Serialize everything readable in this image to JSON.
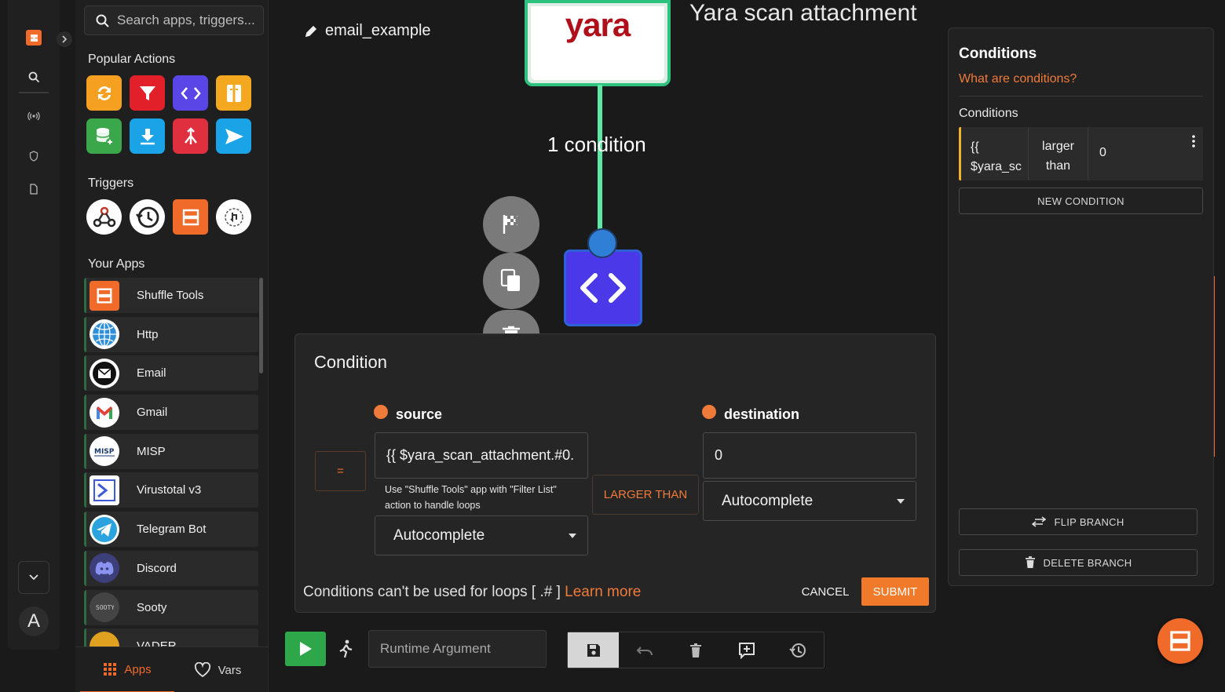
{
  "search": {
    "placeholder": "Search apps, triggers..."
  },
  "sidebar": {
    "popular_actions_title": "Popular Actions",
    "popular_actions": [
      {
        "icon": "refresh-icon",
        "color": "#f6a021"
      },
      {
        "icon": "filter-icon",
        "color": "#e2202a"
      },
      {
        "icon": "code-icon",
        "color": "#5a46e6"
      },
      {
        "icon": "split-page-icon",
        "color": "#f4a820"
      },
      {
        "icon": "database-add-icon",
        "color": "#3aa84a"
      },
      {
        "icon": "download-icon",
        "color": "#1ba3e8"
      },
      {
        "icon": "merge-icon",
        "color": "#e03040"
      },
      {
        "icon": "send-icon",
        "color": "#1ba3e8"
      }
    ],
    "triggers_title": "Triggers",
    "triggers": [
      {
        "icon": "webhook-icon"
      },
      {
        "icon": "schedule-icon"
      },
      {
        "icon": "shuffle-subflow-icon"
      },
      {
        "icon": "user-input-icon"
      }
    ],
    "your_apps_title": "Your Apps",
    "apps": [
      {
        "label": "Shuffle Tools",
        "icon": "shuffle-tools-icon"
      },
      {
        "label": "Http",
        "icon": "globe-icon"
      },
      {
        "label": "Email",
        "icon": "email-icon"
      },
      {
        "label": "Gmail",
        "icon": "gmail-icon"
      },
      {
        "label": "MISP",
        "icon": "misp-icon"
      },
      {
        "label": "Virustotal v3",
        "icon": "virustotal-icon"
      },
      {
        "label": "Telegram Bot",
        "icon": "telegram-icon"
      },
      {
        "label": "Discord",
        "icon": "discord-icon"
      },
      {
        "label": "Sooty",
        "icon": "sooty-icon"
      },
      {
        "label": "VADER",
        "icon": "vader-icon"
      }
    ],
    "tab_apps": "Apps",
    "tab_vars": "Vars"
  },
  "workflow": {
    "name": "email_example",
    "yara_logo": "yara",
    "yara_title": "Yara scan attachment",
    "edge_label": "1 condition"
  },
  "dialog": {
    "title": "Condition",
    "equals_label": "=",
    "source_label": "source",
    "source_value": "{{ $yara_scan_attachment.#0.",
    "source_hint": "Use \"Shuffle Tools\" app with \"Filter List\" action to handle loops",
    "source_select": "Autocomplete",
    "operator": "LARGER THAN",
    "destination_label": "destination",
    "destination_value": "0",
    "destination_select": "Autocomplete",
    "note": "Conditions can't be used for loops [ .# ]",
    "learn_more": "Learn more",
    "cancel": "CANCEL",
    "submit": "SUBMIT"
  },
  "bottom": {
    "runtime_placeholder": "Runtime Argument"
  },
  "panel": {
    "title": "Conditions",
    "what_link": "What are conditions?",
    "subtitle": "Conditions",
    "row": {
      "source": "{{ $yara_sc",
      "operator": "larger than",
      "value": "0"
    },
    "new_condition": "NEW CONDITION",
    "flip_branch": "FLIP BRANCH",
    "delete_branch": "DELETE BRANCH"
  },
  "rail": {
    "avatar": "A"
  },
  "colors": {
    "accent": "#f06a2a",
    "edge": "#5ee8a5",
    "node": "#4b38e8",
    "play": "#2ea64a"
  }
}
